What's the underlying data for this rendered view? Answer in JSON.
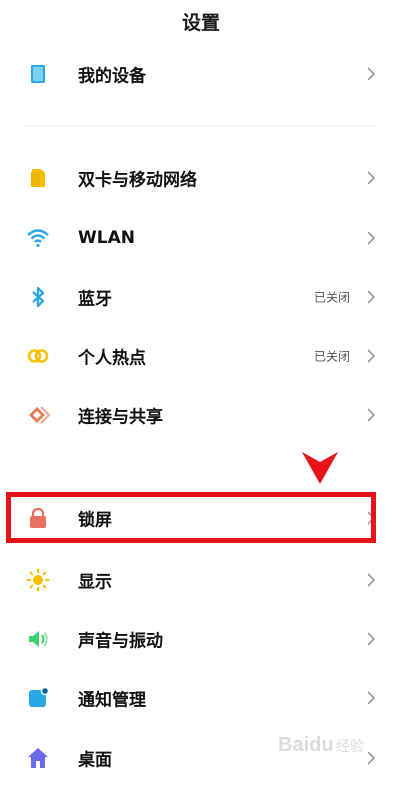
{
  "header": {
    "title": "设置"
  },
  "items": [
    {
      "id": "my-device",
      "label": "我的设备",
      "status": ""
    },
    {
      "id": "sim-network",
      "label": "双卡与移动网络",
      "status": ""
    },
    {
      "id": "wlan",
      "label": "WLAN",
      "status": ""
    },
    {
      "id": "bluetooth",
      "label": "蓝牙",
      "status": "已关闭"
    },
    {
      "id": "hotspot",
      "label": "个人热点",
      "status": "已关闭"
    },
    {
      "id": "connect-share",
      "label": "连接与共享",
      "status": ""
    },
    {
      "id": "lock-screen",
      "label": "锁屏",
      "status": ""
    },
    {
      "id": "display",
      "label": "显示",
      "status": ""
    },
    {
      "id": "sound-vibration",
      "label": "声音与振动",
      "status": ""
    },
    {
      "id": "notifications",
      "label": "通知管理",
      "status": ""
    },
    {
      "id": "desktop",
      "label": "桌面",
      "status": ""
    }
  ],
  "annotation": {
    "highlight_color": "#e8121b"
  },
  "watermark": {
    "brand": "Baidu",
    "sub": "经验"
  },
  "colors": {
    "device": "#29a6e6",
    "sim": "#f5c000",
    "wlan": "#29a6e6",
    "bluetooth": "#29a6e6",
    "hotspot": "#f5c000",
    "share": "#e87a56",
    "lock": "#e8725e",
    "display": "#f5c000",
    "sound": "#3ccf6e",
    "notify": "#29a6e6",
    "desktop": "#6a6be8"
  }
}
